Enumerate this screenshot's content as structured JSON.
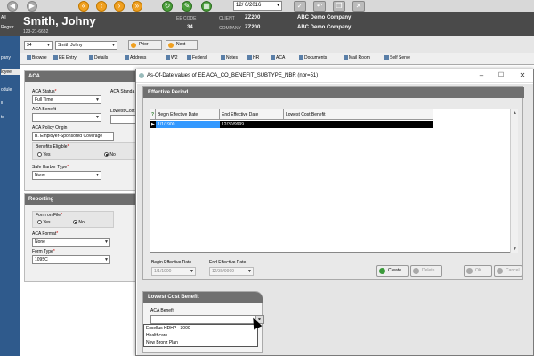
{
  "toolbar": {
    "date_value": "12/ 6/2016"
  },
  "header": {
    "employee_name": "Smith, Johny",
    "employee_ssn": "123-21-6682",
    "ee_code_label": "EE CODE",
    "ee_code_value": "34",
    "client_label": "CLIENT",
    "client_value": "ZZ200",
    "client_name": "ABC Demo Company",
    "company_label": "COMPANY",
    "company_value": "ZZ200",
    "company_name": "ABC Demo Company"
  },
  "leftnav": {
    "items": [
      "All",
      "Regstr",
      "",
      "pany",
      "loyee",
      "",
      "odule",
      "ll",
      "ts"
    ]
  },
  "selector": {
    "ee_number": "34",
    "ee_name": "Smith Johny",
    "prior_label": "Prior",
    "next_label": "Next"
  },
  "tabs": [
    "Browse",
    "EE Entry",
    "Details",
    "Address",
    "W2",
    "Federal",
    "Notes",
    "HR",
    "ACA",
    "Documents",
    "Mail Room",
    "Self Serve"
  ],
  "aca_form": {
    "panel_title": "ACA",
    "status_label": "ACA Status",
    "status_value": "Full Time",
    "standard_label": "ACA Standa",
    "benefit_label": "ACA Benefit",
    "lowest_cost_label": "Lowest Cost",
    "policy_origin_label": "ACA Policy Origin",
    "policy_origin_value": "B. Employer-Sponsored Coverage",
    "benefits_eligible_label": "Benefits Eligible",
    "yes_label": "Yes",
    "no_label": "No",
    "safe_harbor_label": "Safe Harbor Type",
    "safe_harbor_value": "None"
  },
  "reporting": {
    "panel_title": "Reporting",
    "form_on_file_label": "Form on File",
    "yes_label": "Yes",
    "no_label": "No",
    "aca_format_label": "ACA Format",
    "aca_format_value": "None",
    "form_type_label": "Form Type",
    "form_type_value": "1095C"
  },
  "dialog": {
    "title": "As-Of-Date values of EE.ACA_CO_BENEFIT_SUBTYPE_NBR (nbr=51)",
    "effective_period_title": "Effective Period",
    "columns": [
      "Begin Effective Date",
      "End Effective Date",
      "Lowest Cost Benefit"
    ],
    "row": {
      "begin": "1/1/1900",
      "end": "12/30/9999",
      "benefit": ""
    },
    "begin_label": "Begin Effective Date",
    "begin_value": "1/1/1900",
    "end_label": "End Effective Date",
    "end_value": "12/30/9999",
    "create_label": "Create",
    "delete_label": "Delete",
    "ok_label": "OK",
    "cancel_label": "Cancel",
    "lcb_title": "Lowest Cost Benefit",
    "aca_benefit_label": "ACA Benefit",
    "aca_benefit_value": "",
    "dropdown_options": [
      "Excellus HDHP - 3000",
      "Healthcare",
      "New Bronz Plan"
    ]
  }
}
